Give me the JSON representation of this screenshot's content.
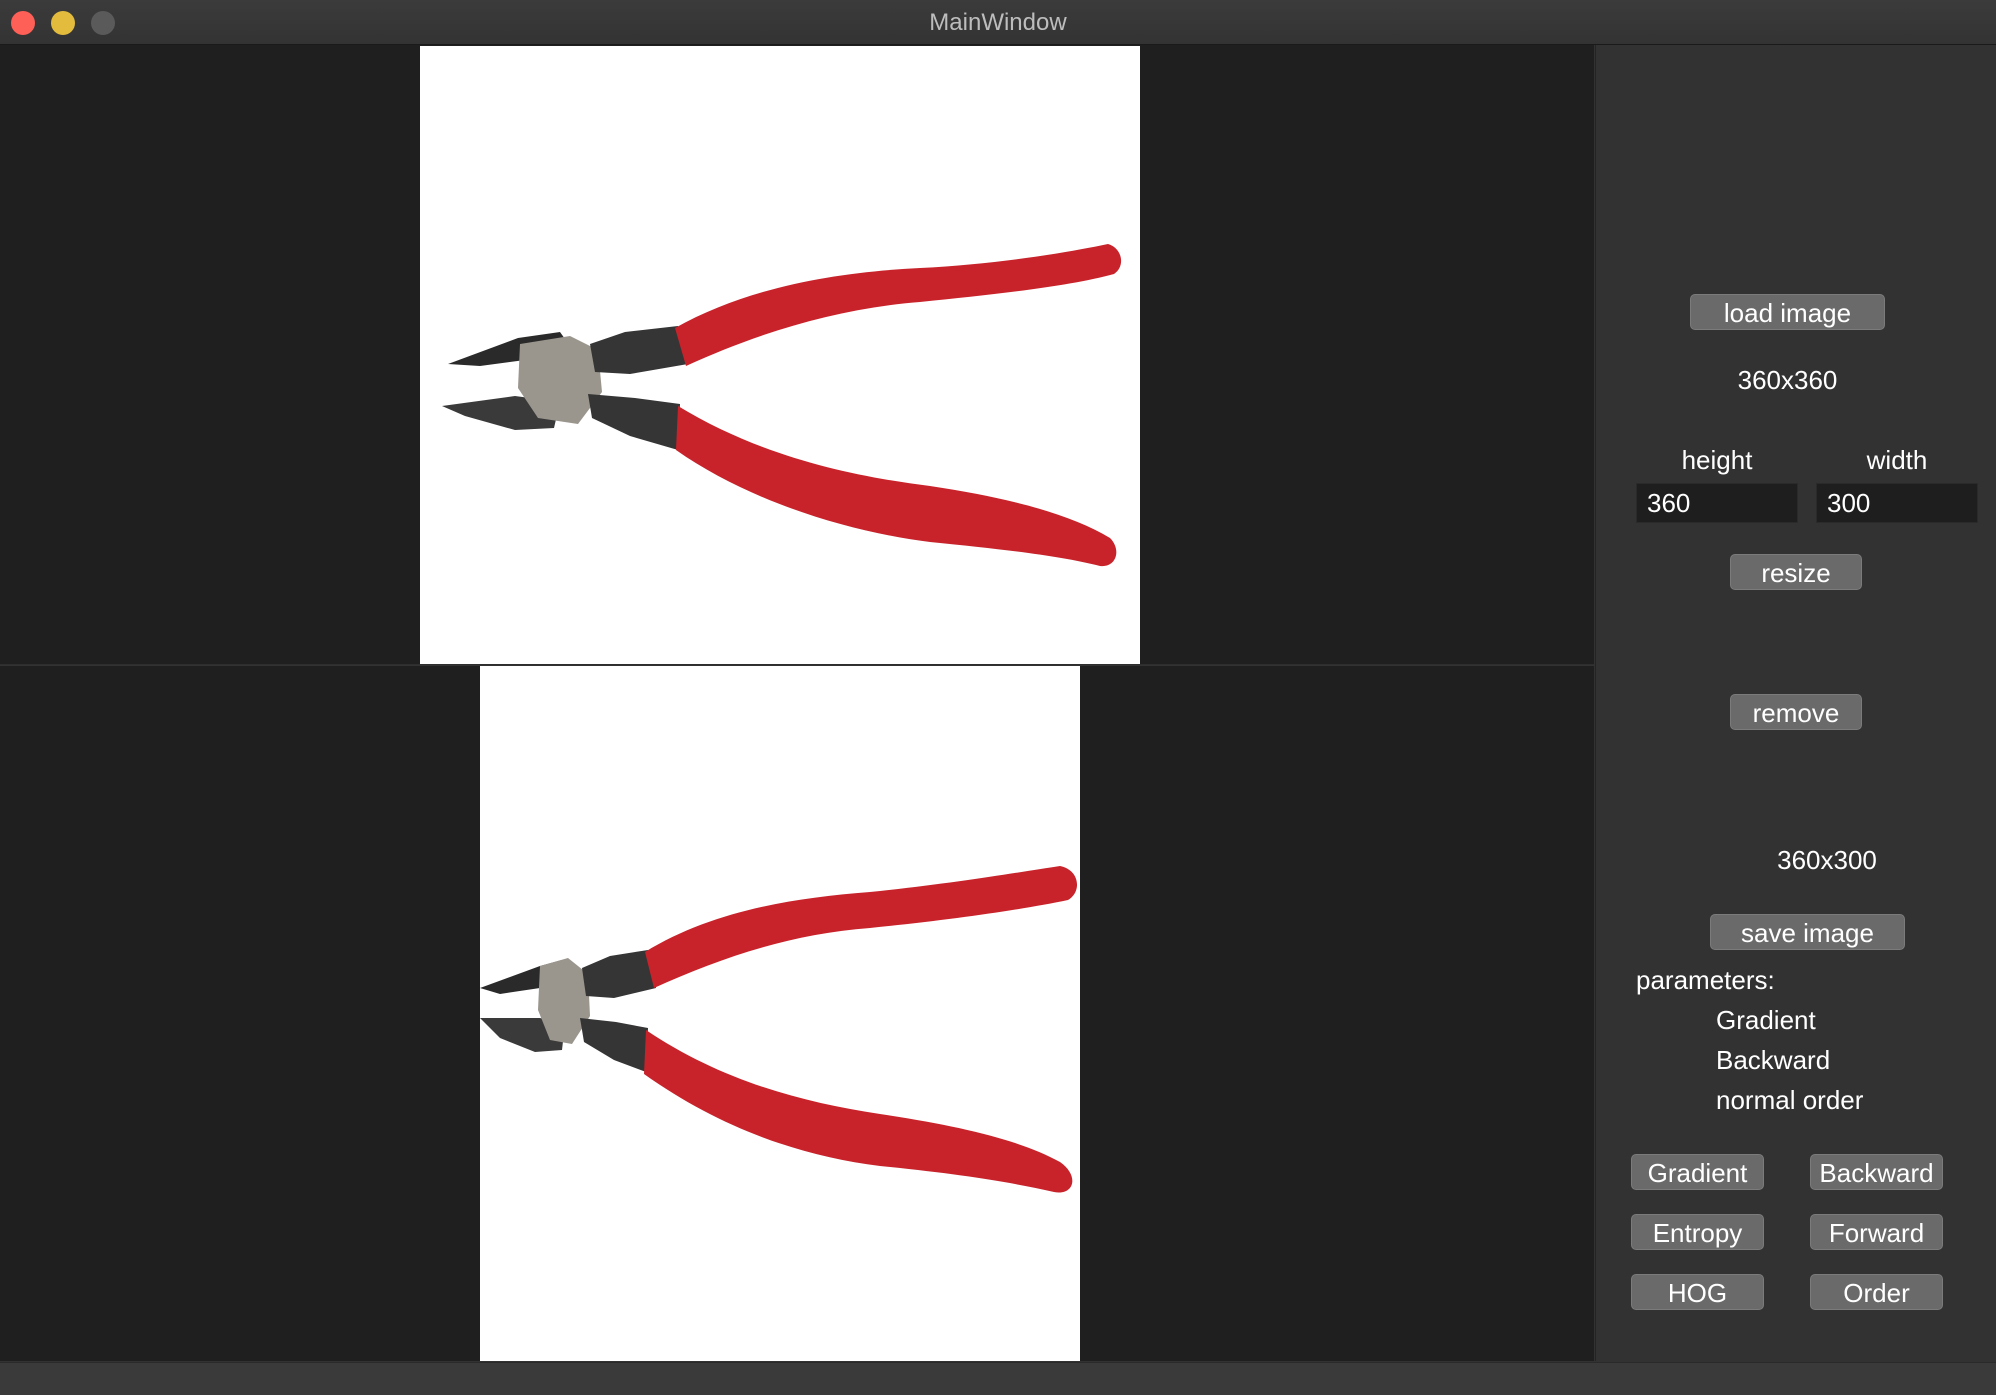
{
  "window": {
    "title": "MainWindow"
  },
  "side": {
    "load_label": "load image",
    "orig_size": "360x360",
    "height_label": "height",
    "width_label": "width",
    "height_value": "360",
    "width_value": "300",
    "resize_label": "resize",
    "remove_label": "remove",
    "result_size": "360x300",
    "save_label": "save image",
    "params_label": "parameters:",
    "params": [
      "Gradient",
      "Backward",
      "normal order"
    ],
    "buttons": [
      "Gradient",
      "Backward",
      "Entropy",
      "Forward",
      "HOG",
      "Order"
    ]
  },
  "colors": {
    "accent_red": "#c8232b",
    "background": "#1f1f1f",
    "panel": "#323232"
  }
}
